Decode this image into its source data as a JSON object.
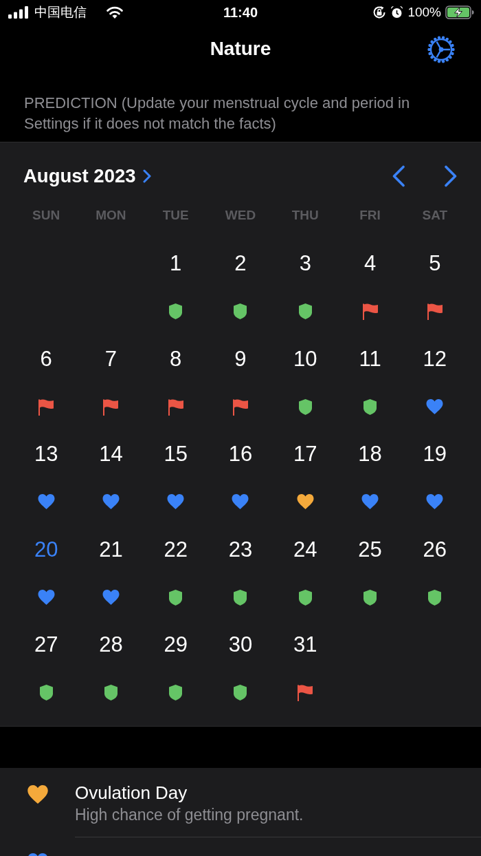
{
  "status_bar": {
    "carrier": "中国电信",
    "time": "11:40",
    "battery": "100%"
  },
  "nav_bar": {
    "title": "Nature"
  },
  "prediction_note": "PREDICTION (Update your menstrual cycle and period in Settings if it does not match the facts)",
  "calendar": {
    "month": "August 2023",
    "weekdays": [
      "SUN",
      "MON",
      "TUE",
      "WED",
      "THU",
      "FRI",
      "SAT"
    ],
    "weeks": [
      {
        "days": [
          {
            "day": "1",
            "kind": "safe",
            "today": false
          },
          {
            "day": "2",
            "kind": "safe",
            "today": false
          },
          {
            "day": "3",
            "kind": "safe",
            "today": false
          },
          {
            "day": "4",
            "kind": "period",
            "today": false
          },
          {
            "day": "5",
            "kind": "period",
            "today": false
          }
        ]
      },
      {
        "days": [
          {
            "day": "6",
            "kind": "period",
            "today": false
          },
          {
            "day": "7",
            "kind": "period",
            "today": false
          },
          {
            "day": "8",
            "kind": "period",
            "today": false
          },
          {
            "day": "9",
            "kind": "period",
            "today": false
          },
          {
            "day": "10",
            "kind": "safe",
            "today": false
          },
          {
            "day": "11",
            "kind": "safe",
            "today": false
          },
          {
            "day": "12",
            "kind": "ovulation",
            "today": false
          }
        ]
      },
      {
        "days": [
          {
            "day": "13",
            "kind": "ovulation",
            "today": false
          },
          {
            "day": "14",
            "kind": "ovulation",
            "today": false
          },
          {
            "day": "15",
            "kind": "ovulation",
            "today": false
          },
          {
            "day": "16",
            "kind": "ovulation",
            "today": false
          },
          {
            "day": "17",
            "kind": "ovulation_day",
            "today": false
          },
          {
            "day": "18",
            "kind": "ovulation",
            "today": false
          },
          {
            "day": "19",
            "kind": "ovulation",
            "today": false
          }
        ]
      },
      {
        "days": [
          {
            "day": "20",
            "kind": "ovulation",
            "today": true
          },
          {
            "day": "21",
            "kind": "ovulation",
            "today": false
          },
          {
            "day": "22",
            "kind": "safe",
            "today": false
          },
          {
            "day": "23",
            "kind": "safe",
            "today": false
          },
          {
            "day": "24",
            "kind": "safe",
            "today": false
          },
          {
            "day": "25",
            "kind": "safe",
            "today": false
          },
          {
            "day": "26",
            "kind": "safe",
            "today": false
          }
        ]
      },
      {
        "days": [
          {
            "day": "27",
            "kind": "safe",
            "today": false
          },
          {
            "day": "28",
            "kind": "safe",
            "today": false
          },
          {
            "day": "29",
            "kind": "safe",
            "today": false
          },
          {
            "day": "30",
            "kind": "safe",
            "today": false
          },
          {
            "day": "31",
            "kind": "period",
            "today": false
          }
        ]
      }
    ]
  },
  "legend": [
    {
      "kind": "ovulation_day",
      "title": "Ovulation Day",
      "subtitle": "High chance of getting pregnant."
    },
    {
      "kind": "ovulation"
    }
  ]
}
